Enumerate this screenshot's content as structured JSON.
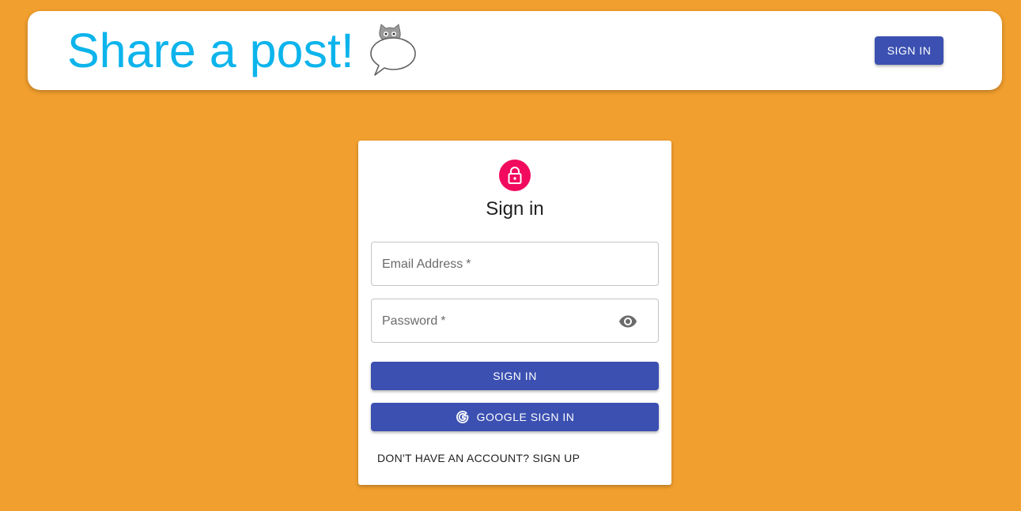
{
  "header": {
    "title": "Share a post!",
    "logo_icon": "speech-bubble-cat-icon",
    "signin_label": "SIGN IN"
  },
  "signin_card": {
    "lock_icon": "lock-icon",
    "title": "Sign in",
    "email": {
      "label": "Email Address",
      "required_mark": "*",
      "value": ""
    },
    "password": {
      "label": "Password",
      "required_mark": "*",
      "value": "",
      "toggle_icon": "eye-icon"
    },
    "signin_button_label": "SIGN IN",
    "google_button_label": "GOOGLE SIGN IN",
    "google_icon": "google-icon",
    "signup_link_label": "DON'T HAVE AN ACCOUNT? SIGN UP"
  },
  "colors": {
    "background": "#f19f2e",
    "brand_title": "#0db4ec",
    "primary_button": "#3b50b1",
    "lock_avatar": "#f10a5e"
  }
}
